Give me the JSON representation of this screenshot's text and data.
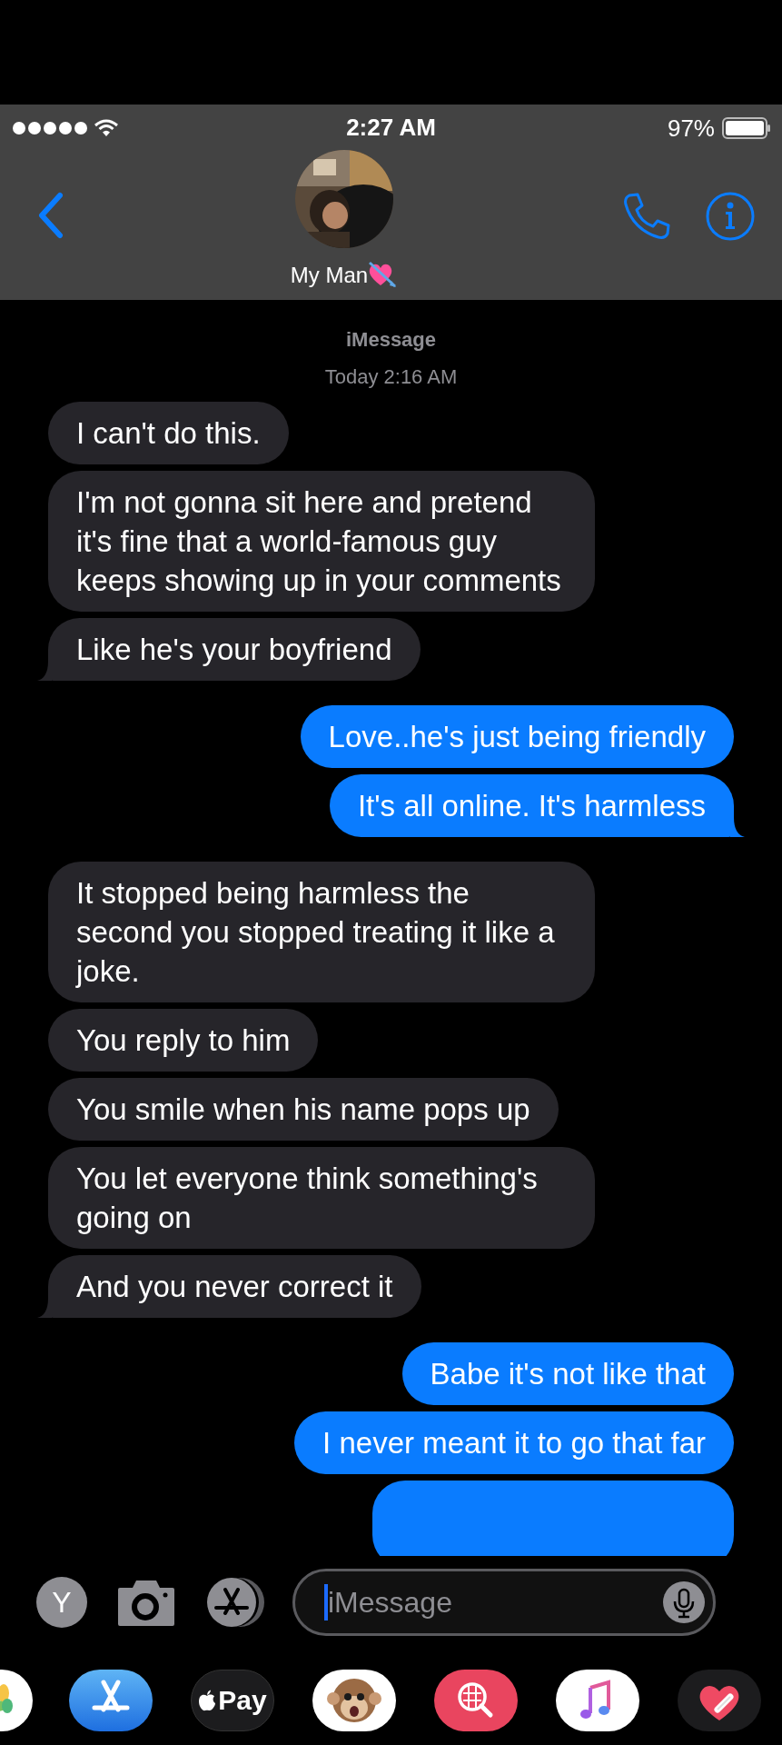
{
  "status_bar": {
    "time": "2:27 AM",
    "battery": "97%"
  },
  "contact": {
    "name": "My Man"
  },
  "service": "iMessage",
  "timestamp": "Today 2:16 AM",
  "messages": [
    {
      "kind": "received",
      "text": "I can't do this.",
      "tail": false
    },
    {
      "kind": "received",
      "text": "I'm not gonna sit here and pretend it's fine that a world-famous guy keeps showing up in your comments",
      "tail": false
    },
    {
      "kind": "received",
      "text": "Like he's your boyfriend",
      "tail": true
    },
    {
      "kind": "sent",
      "text": "Love..he's just being friendly",
      "tail": false
    },
    {
      "kind": "sent",
      "text": "It's all online. It's harmless",
      "tail": true
    },
    {
      "kind": "received",
      "text": "It stopped being harmless the second you stopped treating it like a joke.",
      "tail": false
    },
    {
      "kind": "received",
      "text": "You reply to him",
      "tail": false
    },
    {
      "kind": "received",
      "text": "You smile when his name pops up",
      "tail": false
    },
    {
      "kind": "received",
      "text": "You let everyone think something's going on",
      "tail": false
    },
    {
      "kind": "received",
      "text": "And you never correct it",
      "tail": true
    },
    {
      "kind": "sent",
      "text": "Babe it's not like that",
      "tail": false
    },
    {
      "kind": "sent",
      "text": "I never meant it to go that far",
      "tail": false
    },
    {
      "kind": "sent_cut"
    }
  ],
  "compose": {
    "avatar_letter": "Y",
    "placeholder": "iMessage"
  },
  "apps": [
    {
      "kind": "photos"
    },
    {
      "kind": "appstore"
    },
    {
      "kind": "applepay",
      "label": "Pay"
    },
    {
      "kind": "animoji"
    },
    {
      "kind": "websearch"
    },
    {
      "kind": "music"
    },
    {
      "kind": "stickers"
    }
  ]
}
